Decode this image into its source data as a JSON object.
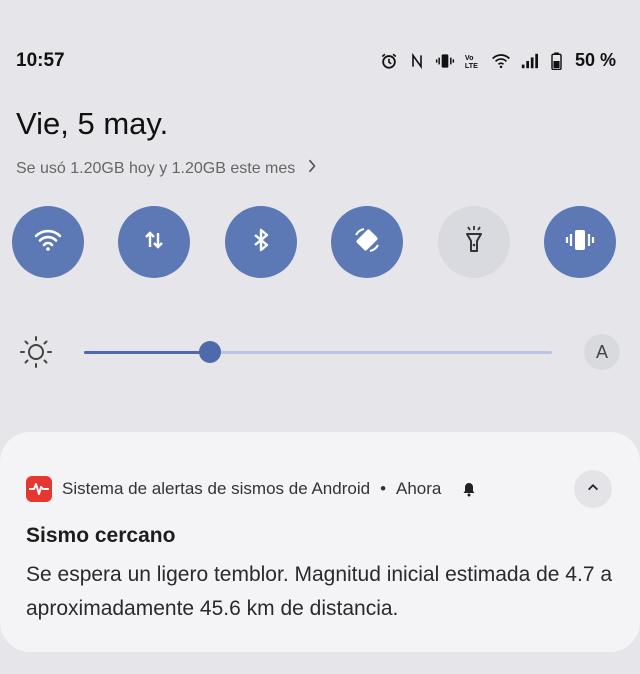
{
  "status_bar": {
    "time": "10:57",
    "icons": [
      "alarm-icon",
      "nfc-icon",
      "vibrate-icon",
      "volte-icon",
      "wifi-icon",
      "signal-icon",
      "battery-icon"
    ],
    "battery_percent": "50 %"
  },
  "header": {
    "date": "Vie, 5 may.",
    "data_usage": "Se usó 1.20GB hoy y 1.20GB este mes"
  },
  "quick_settings": [
    {
      "name": "wifi",
      "icon": "wifi-icon",
      "active": true
    },
    {
      "name": "mobile-data",
      "icon": "data-transfer-icon",
      "active": true
    },
    {
      "name": "bluetooth",
      "icon": "bluetooth-icon",
      "active": true
    },
    {
      "name": "auto-rotate",
      "icon": "rotate-icon",
      "active": true
    },
    {
      "name": "flashlight",
      "icon": "flashlight-icon",
      "active": false
    },
    {
      "name": "sound-mode",
      "icon": "vibrate-icon",
      "active": true
    }
  ],
  "brightness": {
    "level": 0.27,
    "auto_label": "A"
  },
  "notification": {
    "app_name": "Sistema de alertas de sismos de Android",
    "separator": "•",
    "time": "Ahora",
    "title": "Sismo cercano",
    "body": "Se espera un ligero temblor. Magnitud inicial estimada de 4.7 a aproximadamente 45.6 km de distancia."
  },
  "colors": {
    "accent": "#5c79b6",
    "background": "#e6e6ea",
    "alert_red": "#e5362f"
  }
}
